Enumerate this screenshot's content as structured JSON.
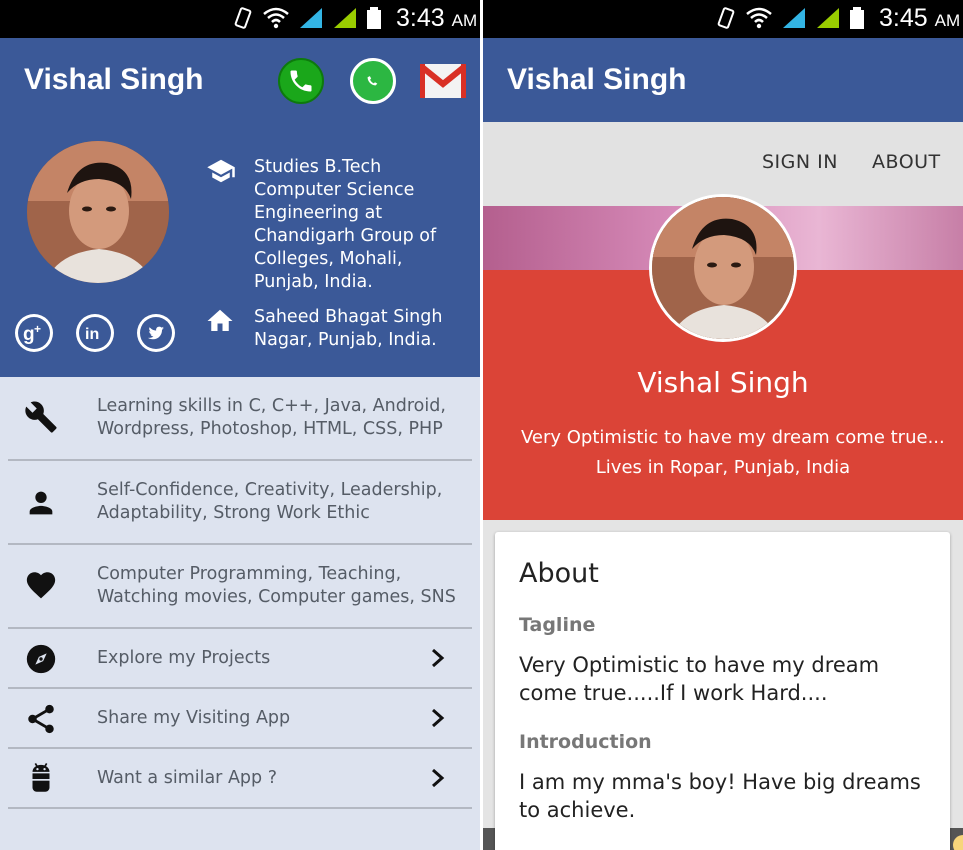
{
  "left": {
    "status": {
      "time": "3:43",
      "ampm": "AM"
    },
    "header": {
      "title": "Vishal Singh"
    },
    "actions": [
      {
        "name": "call-icon",
        "color": "#1aa71a"
      },
      {
        "name": "whatsapp-icon",
        "color": "#2cb742"
      },
      {
        "name": "gmail-icon",
        "color": "#d93025"
      }
    ],
    "info": {
      "education": "Studies B.Tech Computer Science Engineering at Chandigarh Group of Colleges, Mohali, Punjab, India.",
      "home": "Saheed Bhagat Singh Nagar, Punjab, India."
    },
    "social": [
      {
        "name": "google-plus-icon"
      },
      {
        "name": "linkedin-icon"
      },
      {
        "name": "twitter-icon"
      }
    ],
    "list": [
      {
        "icon": "wrench-icon",
        "text": "Learning skills in C, C++, Java, Android, Wordpress, Photoshop, HTML, CSS, PHP",
        "chevron": false
      },
      {
        "icon": "person-icon",
        "text": "Self-Confidence, Creativity, Leadership, Adaptability, Strong Work Ethic",
        "chevron": false
      },
      {
        "icon": "heart-icon",
        "text": "Computer Programming, Teaching, Watching movies, Computer games, SNS",
        "chevron": false
      },
      {
        "icon": "compass-icon",
        "text": "Explore my Projects",
        "chevron": true
      },
      {
        "icon": "share-icon",
        "text": "Share my Visiting App",
        "chevron": true
      },
      {
        "icon": "android-icon",
        "text": "Want a similar App ?",
        "chevron": true
      }
    ],
    "colors": {
      "header": "#3b5998",
      "background": "#dde3ef"
    }
  },
  "right": {
    "status": {
      "time": "3:45",
      "ampm": "AM"
    },
    "header": {
      "title": "Vishal Singh"
    },
    "nav": {
      "signin": "SIGN IN",
      "about": "ABOUT"
    },
    "profile": {
      "name": "Vishal Singh",
      "tagline_short": "Very Optimistic to have my dream come true...",
      "location": "Lives in Ropar, Punjab, India"
    },
    "about": {
      "heading": "About",
      "tagline_label": "Tagline",
      "tagline": "Very Optimistic to have my dream come true.....If I work Hard....",
      "intro_label": "Introduction",
      "intro": "I am my mma's boy! Have big dreams to achieve."
    },
    "colors": {
      "accent": "#db4437",
      "header": "#3b5998"
    }
  }
}
